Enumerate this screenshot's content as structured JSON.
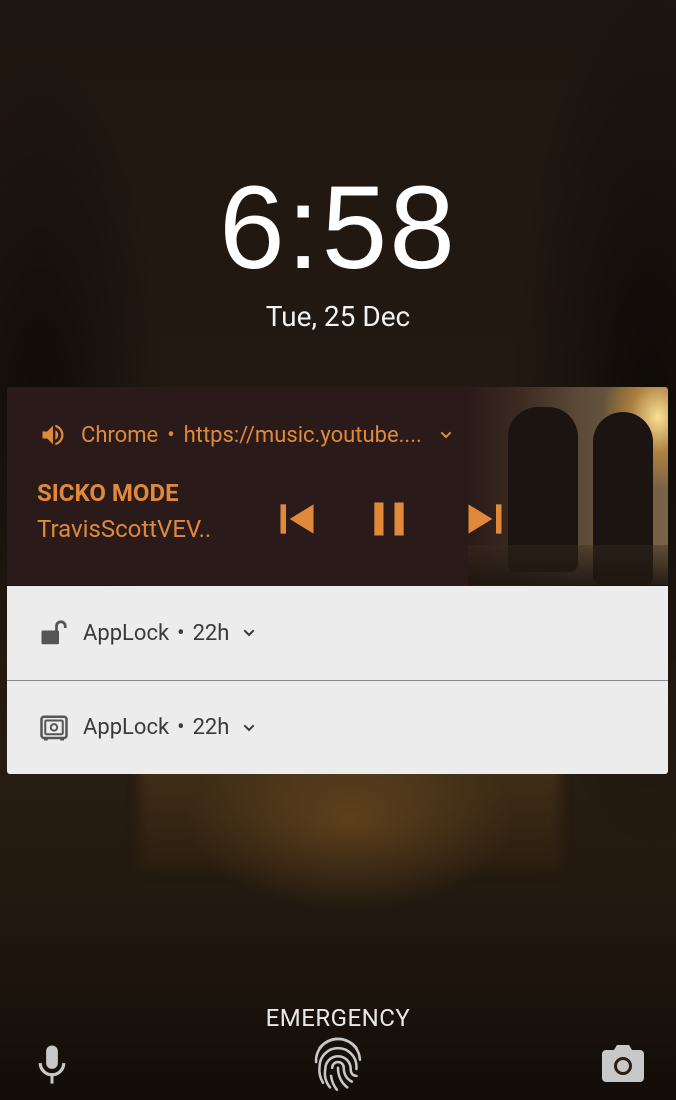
{
  "lockscreen": {
    "time": "6:58",
    "date": "Tue, 25 Dec"
  },
  "media_notification": {
    "app": "Chrome",
    "separator": "•",
    "source": "https://music.youtube....",
    "title": "SICKO MODE",
    "artist": "TravisScottVEV..",
    "accent_color": "#e0893a",
    "controls": [
      "previous-icon",
      "pause-icon",
      "next-icon"
    ]
  },
  "notifications": [
    {
      "app": "AppLock",
      "separator": "•",
      "time": "22h",
      "icon": "unlock-icon"
    },
    {
      "app": "AppLock",
      "separator": "•",
      "time": "22h",
      "icon": "safe-icon"
    }
  ],
  "bottom": {
    "emergency_label": "EMERGENCY",
    "icons": [
      "microphone-icon",
      "fingerprint-icon",
      "camera-icon"
    ]
  }
}
